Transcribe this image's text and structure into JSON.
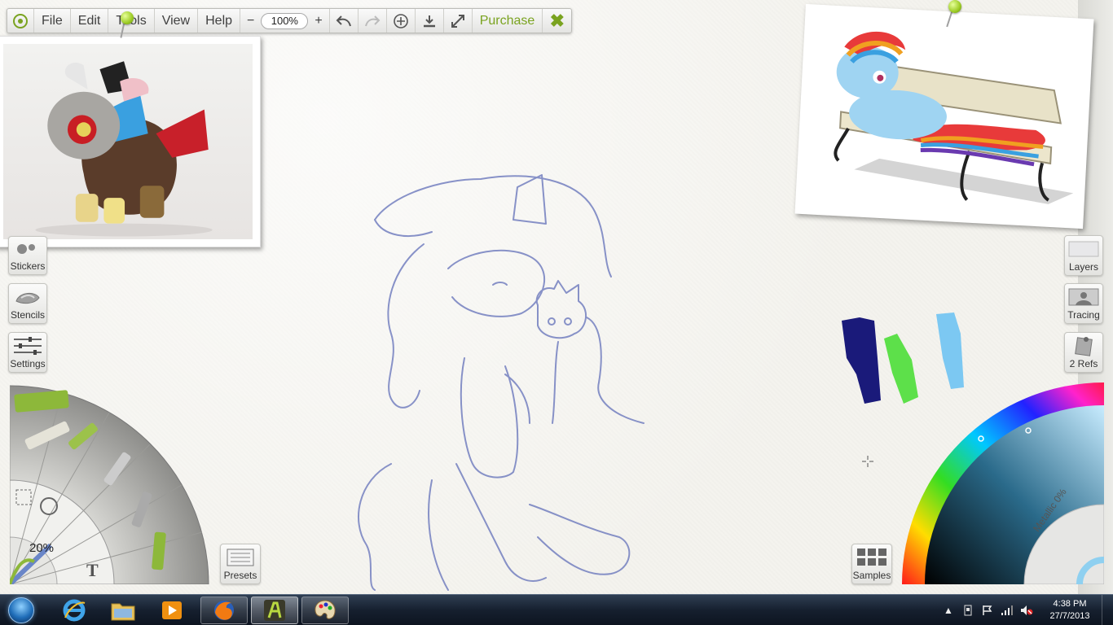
{
  "menu": {
    "items": [
      "File",
      "Edit",
      "Tools",
      "View",
      "Help"
    ],
    "zoom_minus": "−",
    "zoom_value": "100%",
    "zoom_plus": "+",
    "purchase": "Purchase"
  },
  "left_buttons": {
    "stickers": "Stickers",
    "stencils": "Stencils",
    "settings": "Settings"
  },
  "right_buttons": {
    "layers": "Layers",
    "tracing": "Tracing",
    "refs": "2 Refs"
  },
  "tool_wheel": {
    "size_percent": "20%",
    "text_tool_glyph": "T"
  },
  "presets": "Presets",
  "samples": "Samples",
  "color_picker": {
    "metallic_label": "Metallic 0%"
  },
  "swatches": [
    {
      "name": "dark-blue",
      "color": "#1a1a7a"
    },
    {
      "name": "green",
      "color": "#5de04a"
    },
    {
      "name": "light-blue",
      "color": "#7cc8f2"
    }
  ],
  "taskbar": {
    "apps": [
      "internet-explorer",
      "file-explorer",
      "media-player",
      "firefox",
      "artrage",
      "paint"
    ],
    "time": "4:38 PM",
    "date": "27/7/2013"
  },
  "colors": {
    "accent": "#7aa320",
    "sketch": "#6f78b8"
  }
}
